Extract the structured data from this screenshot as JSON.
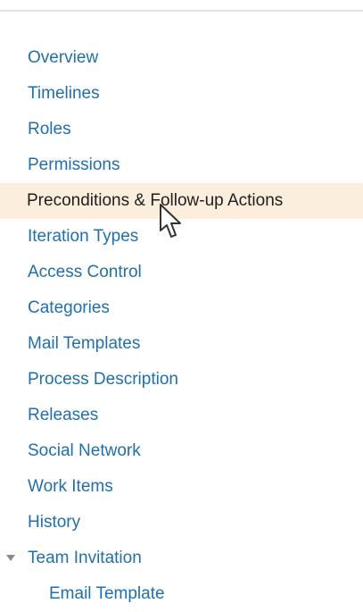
{
  "nav": {
    "items": [
      {
        "label": "Overview"
      },
      {
        "label": "Timelines"
      },
      {
        "label": "Roles"
      },
      {
        "label": "Permissions"
      },
      {
        "label": "Preconditions & Follow-up Actions",
        "selected": true
      },
      {
        "label": "Iteration Types"
      },
      {
        "label": "Access Control"
      },
      {
        "label": "Categories"
      },
      {
        "label": "Mail Templates"
      },
      {
        "label": "Process Description"
      },
      {
        "label": "Releases"
      },
      {
        "label": "Social Network"
      },
      {
        "label": "Work Items"
      },
      {
        "label": "History"
      },
      {
        "label": "Team Invitation",
        "expanded": true,
        "icon": "caret-down-icon"
      },
      {
        "label": "Email Template",
        "indent": 1
      }
    ]
  },
  "colors": {
    "link": "#1f6fb0",
    "selected_background": "#fbeedd",
    "selected_text": "#1f1f1f",
    "divider": "#e3e3e3"
  },
  "cursor": {
    "icon": "mouse-pointer-icon"
  }
}
